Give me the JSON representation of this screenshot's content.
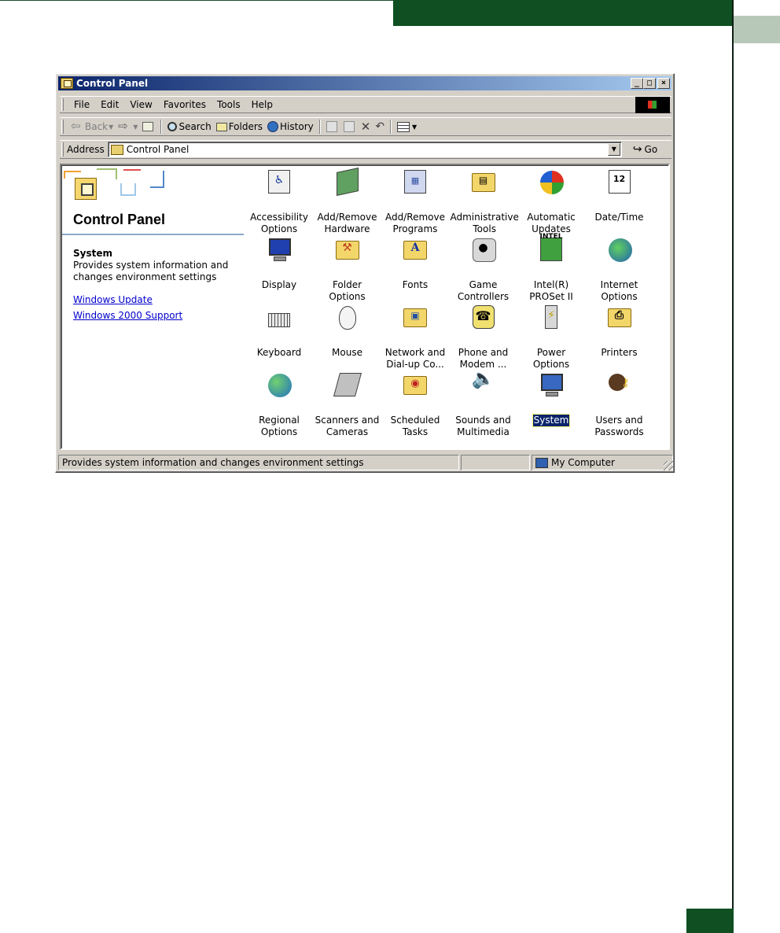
{
  "window": {
    "title": "Control Panel",
    "caption_buttons": [
      "_",
      "□",
      "×"
    ]
  },
  "menu": [
    "File",
    "Edit",
    "View",
    "Favorites",
    "Tools",
    "Help"
  ],
  "toolbar": {
    "back": "Back",
    "search": "Search",
    "folders": "Folders",
    "history": "History"
  },
  "address": {
    "label": "Address",
    "value": "Control Panel",
    "go": "Go"
  },
  "left_pane": {
    "title": "Control Panel",
    "info_title": "System",
    "info_desc": "Provides system information and changes environment settings",
    "links": [
      "Windows Update",
      "Windows 2000 Support"
    ]
  },
  "items": [
    {
      "label": "Accessibility Options",
      "icon": "accessibility-icon"
    },
    {
      "label": "Add/Remove Hardware",
      "icon": "hardware-icon"
    },
    {
      "label": "Add/Remove Programs",
      "icon": "programs-icon"
    },
    {
      "label": "Administrative Tools",
      "icon": "admin-tools-icon"
    },
    {
      "label": "Automatic Updates",
      "icon": "updates-icon"
    },
    {
      "label": "Date/Time",
      "icon": "datetime-icon"
    },
    {
      "label": "Display",
      "icon": "display-icon"
    },
    {
      "label": "Folder Options",
      "icon": "folder-options-icon"
    },
    {
      "label": "Fonts",
      "icon": "fonts-icon"
    },
    {
      "label": "Game Controllers",
      "icon": "joystick-icon"
    },
    {
      "label": "Intel(R) PROSet II",
      "icon": "intel-icon"
    },
    {
      "label": "Internet Options",
      "icon": "internet-icon"
    },
    {
      "label": "Keyboard",
      "icon": "keyboard-icon"
    },
    {
      "label": "Mouse",
      "icon": "mouse-icon"
    },
    {
      "label": "Network and Dial-up Co...",
      "icon": "network-icon"
    },
    {
      "label": "Phone and Modem ...",
      "icon": "phone-icon"
    },
    {
      "label": "Power Options",
      "icon": "power-icon"
    },
    {
      "label": "Printers",
      "icon": "printer-icon"
    },
    {
      "label": "Regional Options",
      "icon": "globe-icon"
    },
    {
      "label": "Scanners and Cameras",
      "icon": "scanner-icon"
    },
    {
      "label": "Scheduled Tasks",
      "icon": "tasks-icon"
    },
    {
      "label": "Sounds and Multimedia",
      "icon": "speaker-icon"
    },
    {
      "label": "System",
      "icon": "computer-icon",
      "selected": true
    },
    {
      "label": "Users and Passwords",
      "icon": "users-icon"
    }
  ],
  "statusbar": {
    "text": "Provides system information and changes environment settings",
    "zone": "My Computer"
  },
  "colors": {
    "accent_green": "#0f4f21",
    "title_gradient_start": "#0a246a",
    "selection": "#0a246a"
  }
}
